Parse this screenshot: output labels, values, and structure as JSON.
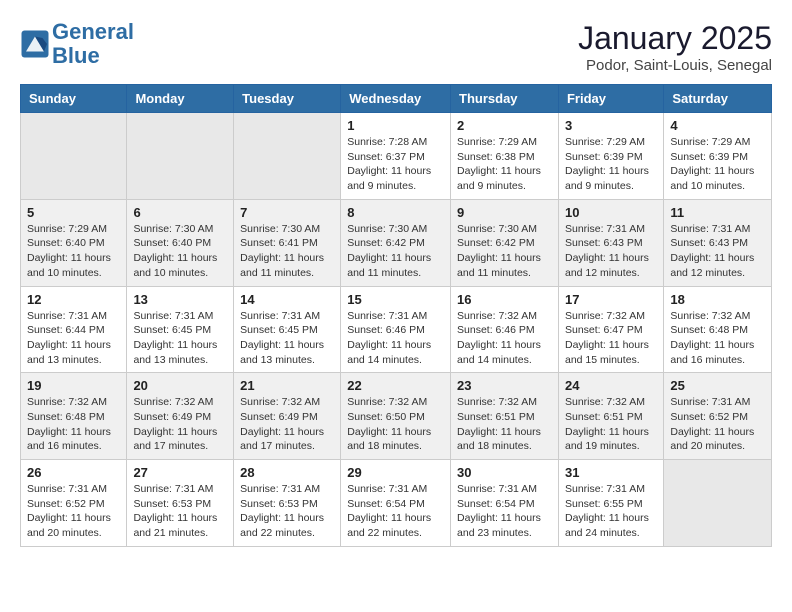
{
  "header": {
    "logo_line1": "General",
    "logo_line2": "Blue",
    "month": "January 2025",
    "location": "Podor, Saint-Louis, Senegal"
  },
  "days_of_week": [
    "Sunday",
    "Monday",
    "Tuesday",
    "Wednesday",
    "Thursday",
    "Friday",
    "Saturday"
  ],
  "weeks": [
    [
      {
        "day": "",
        "info": ""
      },
      {
        "day": "",
        "info": ""
      },
      {
        "day": "",
        "info": ""
      },
      {
        "day": "1",
        "info": "Sunrise: 7:28 AM\nSunset: 6:37 PM\nDaylight: 11 hours and 9 minutes."
      },
      {
        "day": "2",
        "info": "Sunrise: 7:29 AM\nSunset: 6:38 PM\nDaylight: 11 hours and 9 minutes."
      },
      {
        "day": "3",
        "info": "Sunrise: 7:29 AM\nSunset: 6:39 PM\nDaylight: 11 hours and 9 minutes."
      },
      {
        "day": "4",
        "info": "Sunrise: 7:29 AM\nSunset: 6:39 PM\nDaylight: 11 hours and 10 minutes."
      }
    ],
    [
      {
        "day": "5",
        "info": "Sunrise: 7:29 AM\nSunset: 6:40 PM\nDaylight: 11 hours and 10 minutes."
      },
      {
        "day": "6",
        "info": "Sunrise: 7:30 AM\nSunset: 6:40 PM\nDaylight: 11 hours and 10 minutes."
      },
      {
        "day": "7",
        "info": "Sunrise: 7:30 AM\nSunset: 6:41 PM\nDaylight: 11 hours and 11 minutes."
      },
      {
        "day": "8",
        "info": "Sunrise: 7:30 AM\nSunset: 6:42 PM\nDaylight: 11 hours and 11 minutes."
      },
      {
        "day": "9",
        "info": "Sunrise: 7:30 AM\nSunset: 6:42 PM\nDaylight: 11 hours and 11 minutes."
      },
      {
        "day": "10",
        "info": "Sunrise: 7:31 AM\nSunset: 6:43 PM\nDaylight: 11 hours and 12 minutes."
      },
      {
        "day": "11",
        "info": "Sunrise: 7:31 AM\nSunset: 6:43 PM\nDaylight: 11 hours and 12 minutes."
      }
    ],
    [
      {
        "day": "12",
        "info": "Sunrise: 7:31 AM\nSunset: 6:44 PM\nDaylight: 11 hours and 13 minutes."
      },
      {
        "day": "13",
        "info": "Sunrise: 7:31 AM\nSunset: 6:45 PM\nDaylight: 11 hours and 13 minutes."
      },
      {
        "day": "14",
        "info": "Sunrise: 7:31 AM\nSunset: 6:45 PM\nDaylight: 11 hours and 13 minutes."
      },
      {
        "day": "15",
        "info": "Sunrise: 7:31 AM\nSunset: 6:46 PM\nDaylight: 11 hours and 14 minutes."
      },
      {
        "day": "16",
        "info": "Sunrise: 7:32 AM\nSunset: 6:46 PM\nDaylight: 11 hours and 14 minutes."
      },
      {
        "day": "17",
        "info": "Sunrise: 7:32 AM\nSunset: 6:47 PM\nDaylight: 11 hours and 15 minutes."
      },
      {
        "day": "18",
        "info": "Sunrise: 7:32 AM\nSunset: 6:48 PM\nDaylight: 11 hours and 16 minutes."
      }
    ],
    [
      {
        "day": "19",
        "info": "Sunrise: 7:32 AM\nSunset: 6:48 PM\nDaylight: 11 hours and 16 minutes."
      },
      {
        "day": "20",
        "info": "Sunrise: 7:32 AM\nSunset: 6:49 PM\nDaylight: 11 hours and 17 minutes."
      },
      {
        "day": "21",
        "info": "Sunrise: 7:32 AM\nSunset: 6:49 PM\nDaylight: 11 hours and 17 minutes."
      },
      {
        "day": "22",
        "info": "Sunrise: 7:32 AM\nSunset: 6:50 PM\nDaylight: 11 hours and 18 minutes."
      },
      {
        "day": "23",
        "info": "Sunrise: 7:32 AM\nSunset: 6:51 PM\nDaylight: 11 hours and 18 minutes."
      },
      {
        "day": "24",
        "info": "Sunrise: 7:32 AM\nSunset: 6:51 PM\nDaylight: 11 hours and 19 minutes."
      },
      {
        "day": "25",
        "info": "Sunrise: 7:31 AM\nSunset: 6:52 PM\nDaylight: 11 hours and 20 minutes."
      }
    ],
    [
      {
        "day": "26",
        "info": "Sunrise: 7:31 AM\nSunset: 6:52 PM\nDaylight: 11 hours and 20 minutes."
      },
      {
        "day": "27",
        "info": "Sunrise: 7:31 AM\nSunset: 6:53 PM\nDaylight: 11 hours and 21 minutes."
      },
      {
        "day": "28",
        "info": "Sunrise: 7:31 AM\nSunset: 6:53 PM\nDaylight: 11 hours and 22 minutes."
      },
      {
        "day": "29",
        "info": "Sunrise: 7:31 AM\nSunset: 6:54 PM\nDaylight: 11 hours and 22 minutes."
      },
      {
        "day": "30",
        "info": "Sunrise: 7:31 AM\nSunset: 6:54 PM\nDaylight: 11 hours and 23 minutes."
      },
      {
        "day": "31",
        "info": "Sunrise: 7:31 AM\nSunset: 6:55 PM\nDaylight: 11 hours and 24 minutes."
      },
      {
        "day": "",
        "info": ""
      }
    ]
  ]
}
